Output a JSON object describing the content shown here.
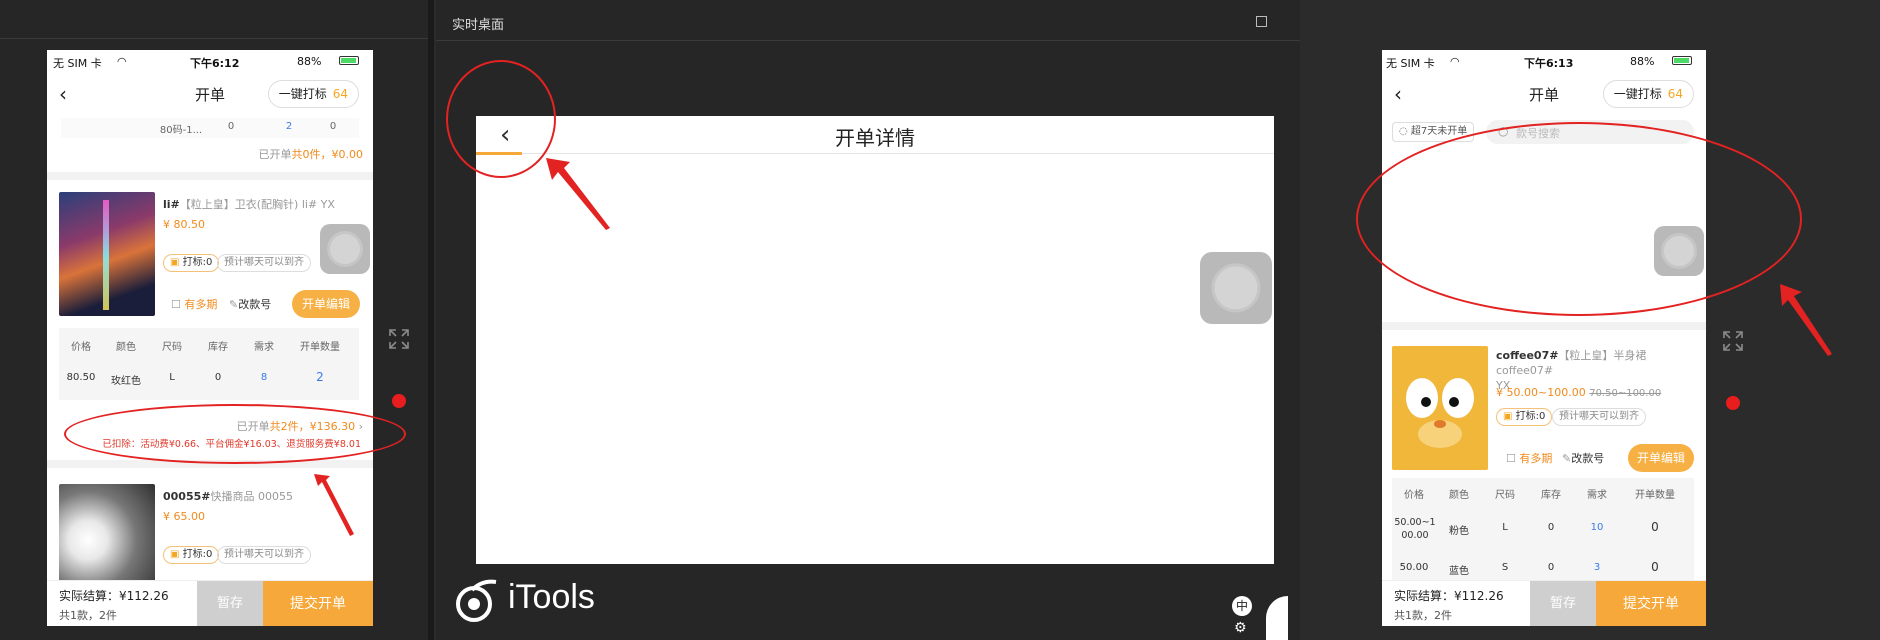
{
  "center_window": {
    "title": "实时桌面",
    "page_title": "开单详情",
    "brand": "iTools",
    "ime_label": "中"
  },
  "left_phone": {
    "status": {
      "carrier": "无 SIM 卡",
      "time": "下午6:12",
      "battery": "88%"
    },
    "nav": {
      "title": "开单",
      "print_label": "一键打标",
      "print_count": "64"
    },
    "top_row": {
      "c1": "80码-1...",
      "c2": "0",
      "c3": "2",
      "c4": "0"
    },
    "top_summary": {
      "prefix": "已开单",
      "value": "共0件，¥0.00"
    },
    "item1": {
      "code": "li#",
      "tag": "【粒上皇】卫衣(配胸针)",
      "sub": "li#  YX",
      "price": "¥ 80.50",
      "print_tag": "打标:0",
      "eta_placeholder": "预计哪天可以到齐",
      "multi_label": "有多期",
      "rename_label": "改款号",
      "edit_label": "开单编辑",
      "table_headers": [
        "价格",
        "颜色",
        "尺码",
        "库存",
        "需求",
        "开单数量"
      ],
      "table_row": [
        "80.50",
        "玫红色",
        "L",
        "0",
        "8",
        "2"
      ],
      "summary_prefix": "已开单",
      "summary_value": "共2件，¥136.30",
      "deduction": "已扣除：活动费¥0.66、平台佣金¥16.03、退货服务费¥8.01"
    },
    "item2": {
      "code": "00055#",
      "tag": "快播商品",
      "sub": "00055",
      "price": "¥ 65.00",
      "print_tag": "打标:0",
      "eta_placeholder": "预计哪天可以到齐"
    },
    "bottom": {
      "settle_label": "实际结算：",
      "settle_value": "¥112.26",
      "count": "共1款，2件",
      "save_label": "暂存",
      "submit_label": "提交开单"
    }
  },
  "right_phone": {
    "status": {
      "carrier": "无 SIM 卡",
      "time": "下午6:13",
      "battery": "88%"
    },
    "nav": {
      "title": "开单",
      "print_label": "一键打标",
      "print_count": "64"
    },
    "filter_label": "超7天未开单",
    "search_placeholder": "款号搜索",
    "item1": {
      "code": "coffee07#",
      "tag": "【粒上皇】半身裙",
      "sub": "coffee07#",
      "sub2": "YX",
      "price": "¥ 50.00~100.00",
      "old_price": "70.50~100.00",
      "print_tag": "打标:0",
      "eta_placeholder": "预计哪天可以到齐",
      "multi_label": "有多期",
      "rename_label": "改款号",
      "edit_label": "开单编辑",
      "table_headers": [
        "价格",
        "颜色",
        "尺码",
        "库存",
        "需求",
        "开单数量"
      ],
      "rows": [
        [
          "50.00~100.00",
          "粉色",
          "L",
          "0",
          "10",
          "0"
        ],
        [
          "50.00",
          "蓝色",
          "S",
          "0",
          "3",
          "0"
        ]
      ]
    },
    "bottom": {
      "settle_label": "实际结算：",
      "settle_value": "¥112.26",
      "count": "共1款，2件",
      "save_label": "暂存",
      "submit_label": "提交开单"
    }
  },
  "colors": {
    "accent": "#f7a83a",
    "price": "#f08a1c",
    "alert": "#e32222",
    "background": "#262626"
  }
}
